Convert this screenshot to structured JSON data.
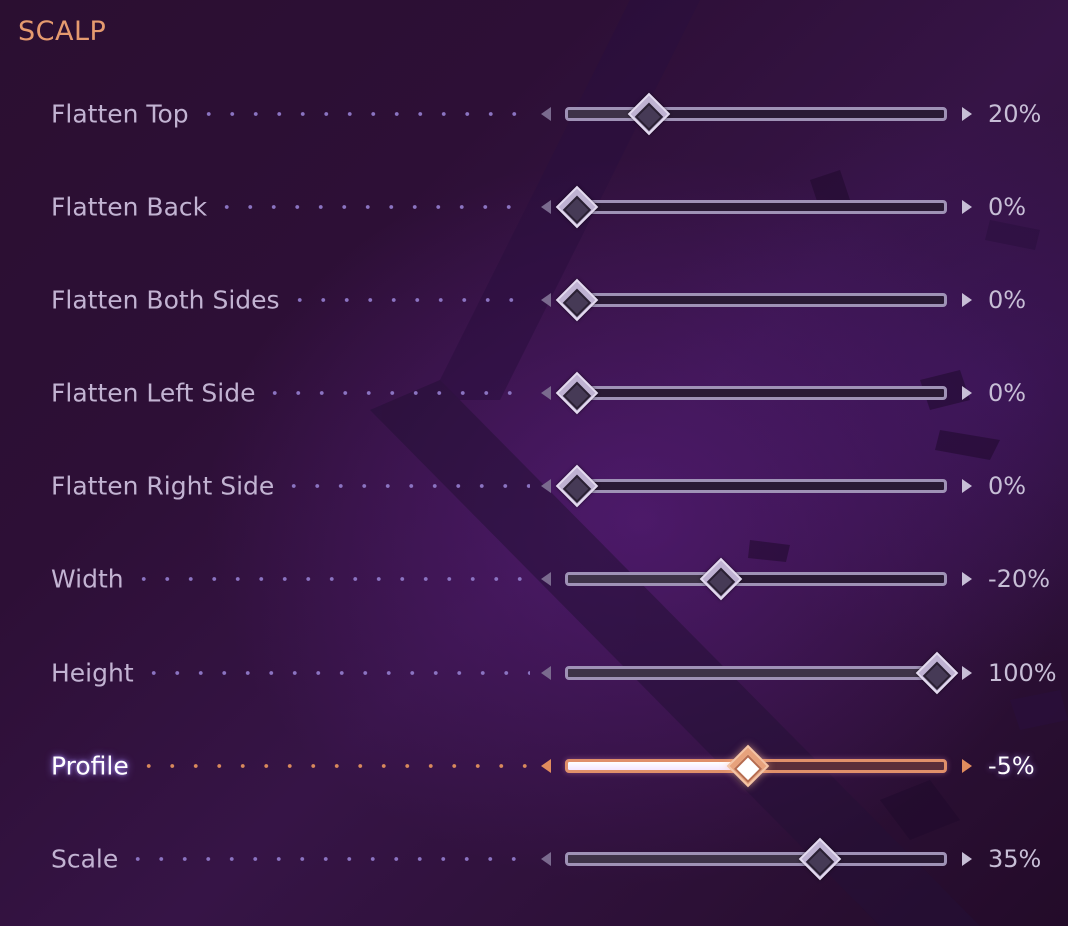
{
  "section": {
    "title": "SCALP"
  },
  "colors": {
    "title_accent": "#e59a6f",
    "label": "#c2b3d2",
    "active_accent": "#e08c5d",
    "background": "#2d0f36"
  },
  "sliders": [
    {
      "label": "Flatten Top",
      "value_text": "20%",
      "fraction": 0.2,
      "active": false
    },
    {
      "label": "Flatten Back",
      "value_text": "0%",
      "fraction": 0.0,
      "active": false
    },
    {
      "label": "Flatten Both Sides",
      "value_text": "0%",
      "fraction": 0.0,
      "active": false
    },
    {
      "label": "Flatten Left Side",
      "value_text": "0%",
      "fraction": 0.0,
      "active": false
    },
    {
      "label": "Flatten Right Side",
      "value_text": "0%",
      "fraction": 0.0,
      "active": false
    },
    {
      "label": "Width",
      "value_text": "-20%",
      "fraction": 0.4,
      "active": false
    },
    {
      "label": "Height",
      "value_text": "100%",
      "fraction": 1.0,
      "active": false
    },
    {
      "label": "Profile",
      "value_text": "-5%",
      "fraction": 0.475,
      "active": true
    },
    {
      "label": "Scale",
      "value_text": "35%",
      "fraction": 0.675,
      "active": false
    }
  ],
  "icons": {
    "decrease": "arrow-left-icon",
    "increase": "arrow-right-icon",
    "thumb": "diamond-thumb-icon"
  }
}
